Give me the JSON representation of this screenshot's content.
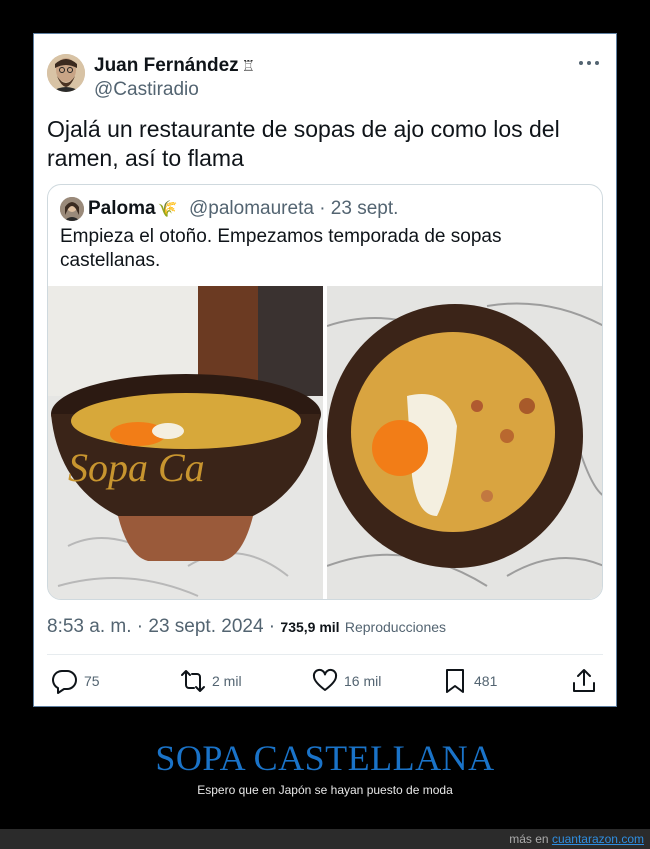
{
  "tweet": {
    "author_name": "Juan Fernández",
    "author_badge": "♖",
    "author_handle": "@Castiradio",
    "text": "Ojalá un restaurante de sopas de ajo como los del ramen, así to flama",
    "quote": {
      "name": "Paloma",
      "name_emoji": "🌾",
      "handle_date": "@palomaureta · 23 sept.",
      "text": "Empieza el otoño. Empezamos temporada de sopas castellanas.",
      "bowl_text": "Sopa Ca"
    },
    "timestamp": "8:53 a. m. · 23 sept. 2024 · ",
    "views_count": "735,9 mil",
    "views_label": "Reproducciones",
    "actions": {
      "replies": "75",
      "retweets": "2 mil",
      "likes": "16 mil",
      "bookmarks": "481"
    }
  },
  "caption": {
    "headline": "SOPA CASTELLANA",
    "subline": "Espero que en Japón se hayan puesto de moda"
  },
  "footer": {
    "prefix": "más en ",
    "site": "cuantarazon.com"
  },
  "colors": {
    "headline": "#1a73c8",
    "card_border": "#5f7fa0",
    "muted_text": "#536471"
  }
}
